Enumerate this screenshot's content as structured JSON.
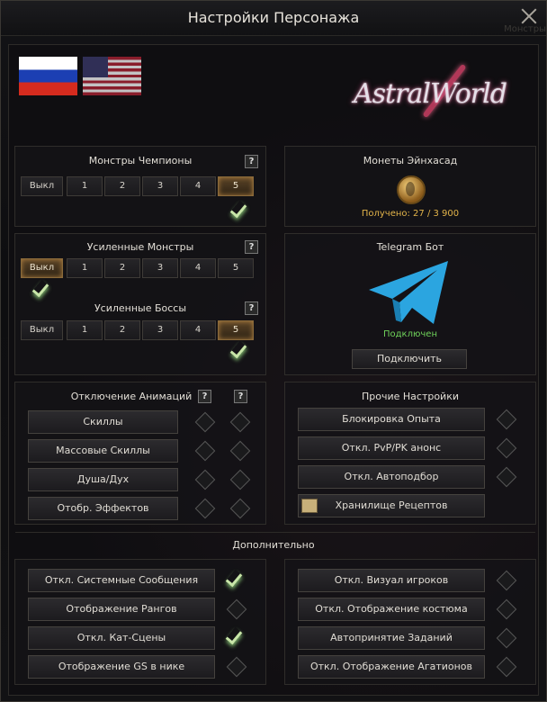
{
  "window": {
    "title": "Настройки Персонажа",
    "ghost_text": "Монстры"
  },
  "logo": {
    "text": "AstralWorld"
  },
  "champion_monsters": {
    "title": "Монстры Чемпионы",
    "help": "?",
    "levels": [
      "Выкл",
      "1",
      "2",
      "3",
      "4",
      "5"
    ],
    "active": 5
  },
  "enhanced_monsters": {
    "title": "Усиленные Монстры",
    "help": "?",
    "levels": [
      "Выкл",
      "1",
      "2",
      "3",
      "4",
      "5"
    ],
    "active": 0
  },
  "enhanced_bosses": {
    "title": "Усиленные Боссы",
    "help": "?",
    "levels": [
      "Выкл",
      "1",
      "2",
      "3",
      "4",
      "5"
    ],
    "active": 5
  },
  "einhasad_coins": {
    "title": "Монеты Эйнхасад",
    "received": "Получено: 27 / 3 900"
  },
  "telegram": {
    "title": "Telegram Бот",
    "status": "Подключен",
    "status_color": "#6fd25a",
    "connect_label": "Подключить"
  },
  "animations": {
    "title": "Отключение Анимаций",
    "help": "?",
    "items": [
      "Скиллы",
      "Массовые Скиллы",
      "Душа/Дух",
      "Отобр. Эффектов"
    ]
  },
  "other": {
    "title": "Прочие Настройки",
    "items": [
      "Блокировка Опыта",
      "Откл. PvP/PK анонс",
      "Откл. Автоподбор",
      "Хранилище Рецептов"
    ]
  },
  "additional": {
    "title": "Дополнительно",
    "left": [
      {
        "label": "Откл. Системные Сообщения",
        "checked": true
      },
      {
        "label": "Отображение Рангов",
        "checked": false
      },
      {
        "label": "Откл. Кат-Сцены",
        "checked": true
      },
      {
        "label": "Отображение GS в нике",
        "checked": false
      }
    ],
    "right": [
      {
        "label": "Откл. Визуал игроков",
        "checked": false
      },
      {
        "label": "Откл. Отображение костюма",
        "checked": false
      },
      {
        "label": "Автопринятие Заданий",
        "checked": false
      },
      {
        "label": "Откл. Отображение Агатионов",
        "checked": false
      }
    ]
  },
  "colors": {
    "accent": "#e3b44a",
    "active_level": "#8a6a3a",
    "check": "#c8e6a8"
  }
}
